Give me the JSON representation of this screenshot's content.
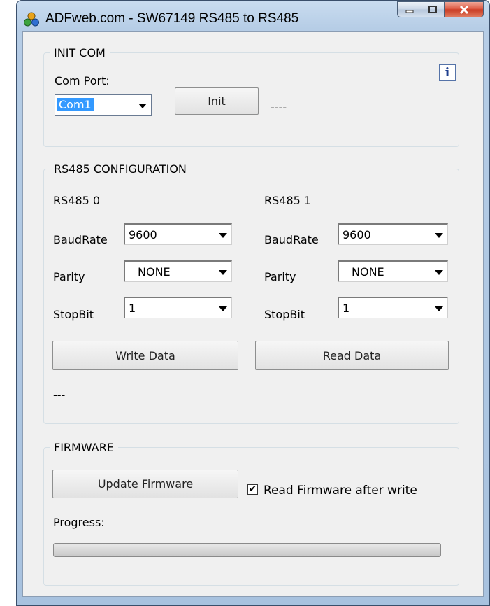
{
  "window": {
    "title": "ADFweb.com - SW67149 RS485 to RS485"
  },
  "init_com": {
    "legend": "INIT COM",
    "com_port_label": "Com Port:",
    "com_port_value": "Com1",
    "init_button": "Init",
    "status": "----"
  },
  "rs485_config": {
    "legend": "RS485 CONFIGURATION",
    "port0": {
      "title": "RS485 0",
      "baudrate_label": "BaudRate",
      "baudrate": "9600",
      "parity_label": "Parity",
      "parity": "NONE",
      "stopbit_label": "StopBit",
      "stopbit": "1"
    },
    "port1": {
      "title": "RS485 1",
      "baudrate_label": "BaudRate",
      "baudrate": "9600",
      "parity_label": "Parity",
      "parity": "NONE",
      "stopbit_label": "StopBit",
      "stopbit": "1"
    },
    "write_button": "Write Data",
    "read_button": "Read Data",
    "status": "---"
  },
  "firmware": {
    "legend": "FIRMWARE",
    "update_button": "Update Firmware",
    "read_after_write_label": "Read Firmware after write",
    "read_after_write_checked": "✔",
    "progress_label": "Progress:",
    "progress_value": 0
  },
  "icons": {
    "app": "adfweb-logo-icon",
    "info": "info-icon"
  }
}
